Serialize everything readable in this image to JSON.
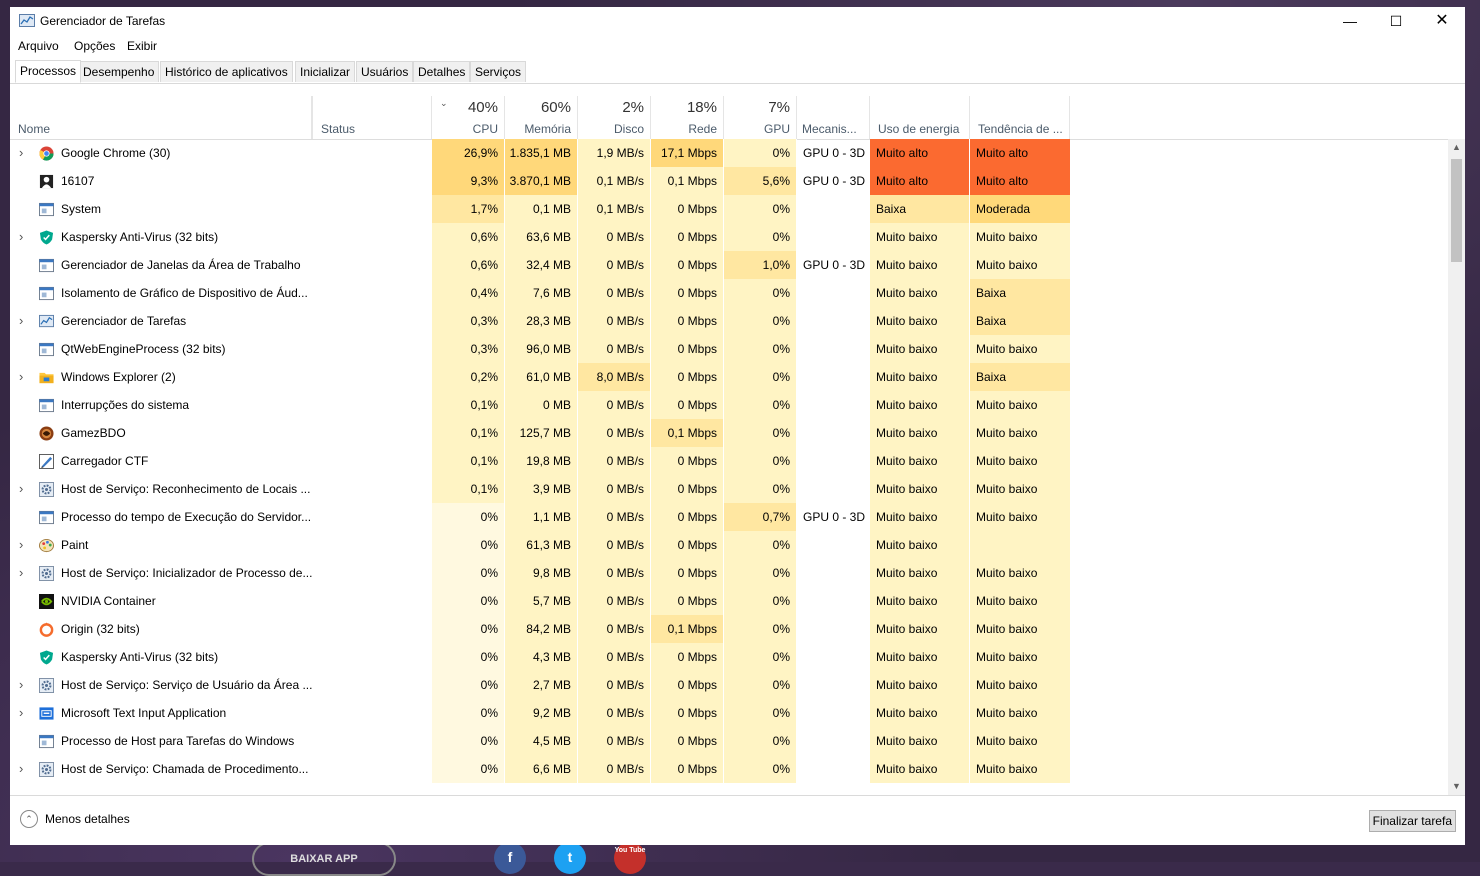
{
  "window": {
    "title": "Gerenciador de Tarefas"
  },
  "menu": [
    "Arquivo",
    "Opções",
    "Exibir"
  ],
  "tabs": [
    "Processos",
    "Desempenho",
    "Histórico de aplicativos",
    "Inicializar",
    "Usuários",
    "Detalhes",
    "Serviços"
  ],
  "header": {
    "name": "Nome",
    "status": "Status",
    "cpu_pct": "40%",
    "cpu": "CPU",
    "mem_pct": "60%",
    "mem": "Memória",
    "disk_pct": "2%",
    "disk": "Disco",
    "net_pct": "18%",
    "net": "Rede",
    "gpu_pct": "7%",
    "gpu": "GPU",
    "gpu_engine": "Mecanis...",
    "power": "Uso de energia",
    "power_trend": "Tendência de ..."
  },
  "colors": {
    "heat_very_high": "#fc6e2d",
    "heat_high": "#ffd87a",
    "heat_mid": "#ffe7a1",
    "heat_low": "#fff4c4",
    "heat_vlow": "#fff9e0",
    "power_high": "#fb6a30",
    "power_mod": "#ffd97a",
    "power_low": "#fff4c4"
  },
  "processes": [
    {
      "name": "Google Chrome (30)",
      "expand": true,
      "icon": "chrome-icon",
      "cpu": "26,9%",
      "mem": "1.835,1 MB",
      "disk": "1,9 MB/s",
      "net": "17,1 Mbps",
      "gpu": "0%",
      "engine": "GPU 0 - 3D",
      "power": "Muito alto",
      "trend": "Muito alto",
      "cpuH": 3,
      "memH": 3,
      "diskH": 1,
      "netH": 3,
      "gpuH": 1,
      "powH": 2,
      "trendH": 2
    },
    {
      "name": "16107",
      "expand": false,
      "icon": "game-icon",
      "cpu": "9,3%",
      "mem": "3.870,1 MB",
      "disk": "0,1 MB/s",
      "net": "0,1 Mbps",
      "gpu": "5,6%",
      "engine": "GPU 0 - 3D",
      "power": "Muito alto",
      "trend": "Muito alto",
      "cpuH": 3,
      "memH": 3,
      "diskH": 1,
      "netH": 1,
      "gpuH": 2,
      "powH": 2,
      "trendH": 2
    },
    {
      "name": "System",
      "expand": false,
      "icon": "window-icon",
      "cpu": "1,7%",
      "mem": "0,1 MB",
      "disk": "0,1 MB/s",
      "net": "0 Mbps",
      "gpu": "0%",
      "engine": "",
      "power": "Baixa",
      "trend": "Moderada",
      "cpuH": 2,
      "memH": 1,
      "diskH": 1,
      "netH": 1,
      "gpuH": 1,
      "powH": 1,
      "trendH": 3
    },
    {
      "name": "Kaspersky Anti-Virus (32 bits)",
      "expand": true,
      "icon": "shield-icon",
      "cpu": "0,6%",
      "mem": "63,6 MB",
      "disk": "0 MB/s",
      "net": "0 Mbps",
      "gpu": "0%",
      "engine": "",
      "power": "Muito baixo",
      "trend": "Muito baixo",
      "cpuH": 1,
      "memH": 1,
      "diskH": 1,
      "netH": 1,
      "gpuH": 1,
      "powH": 0,
      "trendH": 0
    },
    {
      "name": "Gerenciador de Janelas da Área de Trabalho",
      "expand": false,
      "icon": "window-icon",
      "cpu": "0,6%",
      "mem": "32,4 MB",
      "disk": "0 MB/s",
      "net": "0 Mbps",
      "gpu": "1,0%",
      "engine": "GPU 0 - 3D",
      "power": "Muito baixo",
      "trend": "Muito baixo",
      "cpuH": 1,
      "memH": 1,
      "diskH": 1,
      "netH": 1,
      "gpuH": 2,
      "powH": 0,
      "trendH": 0
    },
    {
      "name": "Isolamento de Gráfico de Dispositivo de Áud...",
      "expand": false,
      "icon": "window-icon",
      "cpu": "0,4%",
      "mem": "7,6 MB",
      "disk": "0 MB/s",
      "net": "0 Mbps",
      "gpu": "0%",
      "engine": "",
      "power": "Muito baixo",
      "trend": "Baixa",
      "cpuH": 1,
      "memH": 1,
      "diskH": 1,
      "netH": 1,
      "gpuH": 1,
      "powH": 0,
      "trendH": 1
    },
    {
      "name": "Gerenciador de Tarefas",
      "expand": true,
      "icon": "taskmgr-icon",
      "cpu": "0,3%",
      "mem": "28,3 MB",
      "disk": "0 MB/s",
      "net": "0 Mbps",
      "gpu": "0%",
      "engine": "",
      "power": "Muito baixo",
      "trend": "Baixa",
      "cpuH": 1,
      "memH": 1,
      "diskH": 1,
      "netH": 1,
      "gpuH": 1,
      "powH": 0,
      "trendH": 1
    },
    {
      "name": "QtWebEngineProcess (32 bits)",
      "expand": false,
      "icon": "window-icon",
      "cpu": "0,3%",
      "mem": "96,0 MB",
      "disk": "0 MB/s",
      "net": "0 Mbps",
      "gpu": "0%",
      "engine": "",
      "power": "Muito baixo",
      "trend": "Muito baixo",
      "cpuH": 1,
      "memH": 1,
      "diskH": 1,
      "netH": 1,
      "gpuH": 1,
      "powH": 0,
      "trendH": 0
    },
    {
      "name": "Windows Explorer (2)",
      "expand": true,
      "icon": "folder-icon",
      "cpu": "0,2%",
      "mem": "61,0 MB",
      "disk": "8,0 MB/s",
      "net": "0 Mbps",
      "gpu": "0%",
      "engine": "",
      "power": "Muito baixo",
      "trend": "Baixa",
      "cpuH": 1,
      "memH": 1,
      "diskH": 2,
      "netH": 1,
      "gpuH": 1,
      "powH": 0,
      "trendH": 1
    },
    {
      "name": "Interrupções do sistema",
      "expand": false,
      "icon": "window-icon",
      "cpu": "0,1%",
      "mem": "0 MB",
      "disk": "0 MB/s",
      "net": "0 Mbps",
      "gpu": "0%",
      "engine": "",
      "power": "Muito baixo",
      "trend": "Muito baixo",
      "cpuH": 1,
      "memH": 1,
      "diskH": 1,
      "netH": 1,
      "gpuH": 1,
      "powH": 0,
      "trendH": 0
    },
    {
      "name": "GamezBDO",
      "expand": false,
      "icon": "bdo-icon",
      "cpu": "0,1%",
      "mem": "125,7 MB",
      "disk": "0 MB/s",
      "net": "0,1 Mbps",
      "gpu": "0%",
      "engine": "",
      "power": "Muito baixo",
      "trend": "Muito baixo",
      "cpuH": 1,
      "memH": 1,
      "diskH": 1,
      "netH": 2,
      "gpuH": 1,
      "powH": 0,
      "trendH": 0
    },
    {
      "name": "Carregador CTF",
      "expand": false,
      "icon": "ctf-icon",
      "cpu": "0,1%",
      "mem": "19,8 MB",
      "disk": "0 MB/s",
      "net": "0 Mbps",
      "gpu": "0%",
      "engine": "",
      "power": "Muito baixo",
      "trend": "Muito baixo",
      "cpuH": 1,
      "memH": 1,
      "diskH": 1,
      "netH": 1,
      "gpuH": 1,
      "powH": 0,
      "trendH": 0
    },
    {
      "name": "Host de Serviço: Reconhecimento de Locais ...",
      "expand": true,
      "icon": "gear-icon",
      "cpu": "0,1%",
      "mem": "3,9 MB",
      "disk": "0 MB/s",
      "net": "0 Mbps",
      "gpu": "0%",
      "engine": "",
      "power": "Muito baixo",
      "trend": "Muito baixo",
      "cpuH": 1,
      "memH": 1,
      "diskH": 1,
      "netH": 1,
      "gpuH": 1,
      "powH": 0,
      "trendH": 0
    },
    {
      "name": "Processo do tempo de Execução do Servidor...",
      "expand": false,
      "icon": "window-icon",
      "cpu": "0%",
      "mem": "1,1 MB",
      "disk": "0 MB/s",
      "net": "0 Mbps",
      "gpu": "0,7%",
      "engine": "GPU 0 - 3D",
      "power": "Muito baixo",
      "trend": "Muito baixo",
      "cpuH": 0,
      "memH": 1,
      "diskH": 1,
      "netH": 1,
      "gpuH": 2,
      "powH": 0,
      "trendH": 0
    },
    {
      "name": "Paint",
      "expand": true,
      "icon": "paint-icon",
      "cpu": "0%",
      "mem": "61,3 MB",
      "disk": "0 MB/s",
      "net": "0 Mbps",
      "gpu": "0%",
      "engine": "",
      "power": "Muito baixo",
      "trend": "",
      "cpuH": 0,
      "memH": 1,
      "diskH": 1,
      "netH": 1,
      "gpuH": 1,
      "powH": 0,
      "trendH": 0
    },
    {
      "name": "Host de Serviço: Inicializador de Processo de...",
      "expand": true,
      "icon": "gear-icon",
      "cpu": "0%",
      "mem": "9,8 MB",
      "disk": "0 MB/s",
      "net": "0 Mbps",
      "gpu": "0%",
      "engine": "",
      "power": "Muito baixo",
      "trend": "Muito baixo",
      "cpuH": 0,
      "memH": 1,
      "diskH": 1,
      "netH": 1,
      "gpuH": 1,
      "powH": 0,
      "trendH": 0
    },
    {
      "name": "NVIDIA Container",
      "expand": false,
      "icon": "nvidia-icon",
      "cpu": "0%",
      "mem": "5,7 MB",
      "disk": "0 MB/s",
      "net": "0 Mbps",
      "gpu": "0%",
      "engine": "",
      "power": "Muito baixo",
      "trend": "Muito baixo",
      "cpuH": 0,
      "memH": 1,
      "diskH": 1,
      "netH": 1,
      "gpuH": 1,
      "powH": 0,
      "trendH": 0
    },
    {
      "name": "Origin (32 bits)",
      "expand": false,
      "icon": "origin-icon",
      "cpu": "0%",
      "mem": "84,2 MB",
      "disk": "0 MB/s",
      "net": "0,1 Mbps",
      "gpu": "0%",
      "engine": "",
      "power": "Muito baixo",
      "trend": "Muito baixo",
      "cpuH": 0,
      "memH": 1,
      "diskH": 1,
      "netH": 2,
      "gpuH": 1,
      "powH": 0,
      "trendH": 0
    },
    {
      "name": "Kaspersky Anti-Virus (32 bits)",
      "expand": false,
      "icon": "shield-icon",
      "cpu": "0%",
      "mem": "4,3 MB",
      "disk": "0 MB/s",
      "net": "0 Mbps",
      "gpu": "0%",
      "engine": "",
      "power": "Muito baixo",
      "trend": "Muito baixo",
      "cpuH": 0,
      "memH": 1,
      "diskH": 1,
      "netH": 1,
      "gpuH": 1,
      "powH": 0,
      "trendH": 0
    },
    {
      "name": "Host de Serviço: Serviço de Usuário da Área ...",
      "expand": true,
      "icon": "gear-icon",
      "cpu": "0%",
      "mem": "2,7 MB",
      "disk": "0 MB/s",
      "net": "0 Mbps",
      "gpu": "0%",
      "engine": "",
      "power": "Muito baixo",
      "trend": "Muito baixo",
      "cpuH": 0,
      "memH": 1,
      "diskH": 1,
      "netH": 1,
      "gpuH": 1,
      "powH": 0,
      "trendH": 0
    },
    {
      "name": "Microsoft Text Input Application",
      "expand": true,
      "icon": "input-icon",
      "cpu": "0%",
      "mem": "9,2 MB",
      "disk": "0 MB/s",
      "net": "0 Mbps",
      "gpu": "0%",
      "engine": "",
      "power": "Muito baixo",
      "trend": "Muito baixo",
      "cpuH": 0,
      "memH": 1,
      "diskH": 1,
      "netH": 1,
      "gpuH": 1,
      "powH": 0,
      "trendH": 0
    },
    {
      "name": "Processo de Host para Tarefas do Windows",
      "expand": false,
      "icon": "window-icon",
      "cpu": "0%",
      "mem": "4,5 MB",
      "disk": "0 MB/s",
      "net": "0 Mbps",
      "gpu": "0%",
      "engine": "",
      "power": "Muito baixo",
      "trend": "Muito baixo",
      "cpuH": 0,
      "memH": 1,
      "diskH": 1,
      "netH": 1,
      "gpuH": 1,
      "powH": 0,
      "trendH": 0
    },
    {
      "name": "Host de Serviço: Chamada de Procedimento...",
      "expand": true,
      "icon": "gear-icon",
      "cpu": "0%",
      "mem": "6,6 MB",
      "disk": "0 MB/s",
      "net": "0 Mbps",
      "gpu": "0%",
      "engine": "",
      "power": "Muito baixo",
      "trend": "Muito baixo",
      "cpuH": 0,
      "memH": 1,
      "diskH": 1,
      "netH": 1,
      "gpuH": 1,
      "powH": 0,
      "trendH": 0
    }
  ],
  "footer": {
    "less_details": "Menos detalhes",
    "end_task": "Finalizar tarefa"
  },
  "background": {
    "download_label": "BAIXAR APP",
    "social": [
      "f",
      "t",
      "You Tube"
    ]
  }
}
